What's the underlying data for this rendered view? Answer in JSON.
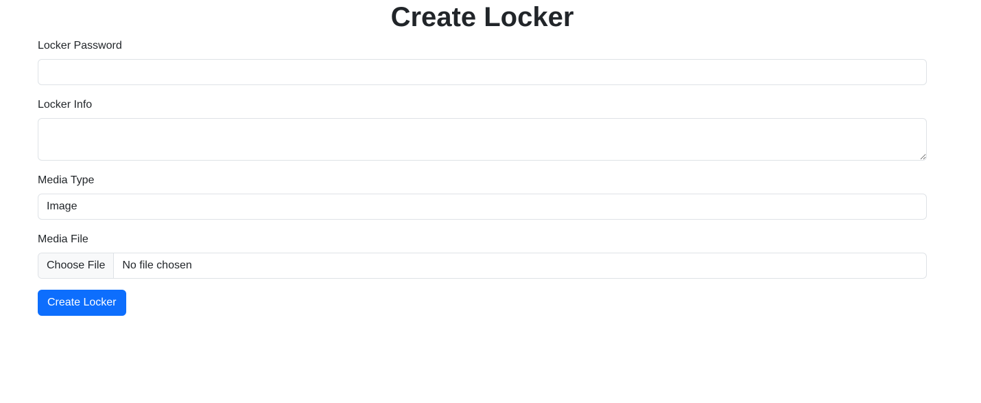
{
  "page": {
    "title": "Create Locker"
  },
  "form": {
    "password": {
      "label": "Locker Password",
      "value": "",
      "placeholder": ""
    },
    "info": {
      "label": "Locker Info",
      "value": "",
      "placeholder": ""
    },
    "media_type": {
      "label": "Media Type",
      "selected": "Image"
    },
    "media_file": {
      "label": "Media File",
      "button_label": "Choose File",
      "status": "No file chosen"
    },
    "submit_label": "Create Locker"
  },
  "colors": {
    "primary": "#0d6efd",
    "text": "#212529",
    "border": "#dee2e6",
    "file_button_bg": "#f8f9fa"
  }
}
